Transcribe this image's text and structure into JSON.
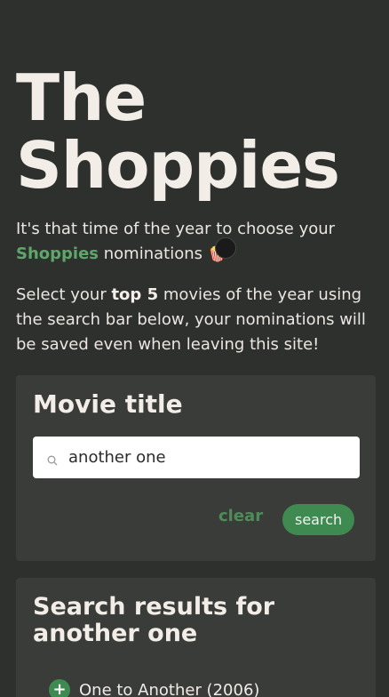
{
  "header": {
    "title_line1": "The",
    "title_line2": "Shoppies"
  },
  "intro": {
    "before": "It's that time of the year to choose your",
    "brand": "Shoppies",
    "after": "nominations",
    "emoji": "🍿"
  },
  "description": {
    "part1": "Select your ",
    "bold": "top 5",
    "part2": " movies of the year using the search bar below, your nominations will be saved even when leaving this site!"
  },
  "search_card": {
    "label": "Movie title",
    "input_value": "another one",
    "clear_label": "clear",
    "search_label": "search",
    "icon": "search-icon"
  },
  "results_card": {
    "title": "Search results for another one",
    "items": [
      {
        "label": "One to Another (2006)",
        "icon": "add-icon"
      }
    ]
  },
  "colors": {
    "background": "#2e302d",
    "card": "#3a3c39",
    "accent": "#3f8a50",
    "brand_text": "#5ea66a"
  }
}
